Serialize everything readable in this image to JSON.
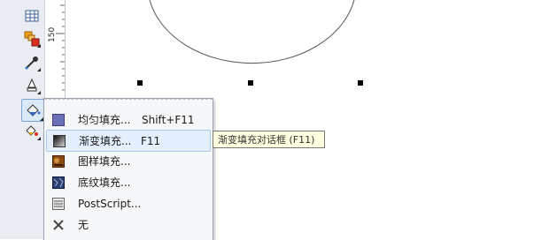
{
  "ruler": {
    "label": "150"
  },
  "toolbox": {
    "tools": [
      {
        "name": "table-tool-icon"
      },
      {
        "name": "blend-tool-icon"
      },
      {
        "name": "eyedropper-tool-icon"
      },
      {
        "name": "outline-tool-icon"
      },
      {
        "name": "fill-tool-icon",
        "active": true
      },
      {
        "name": "interactive-fill-tool-icon"
      }
    ]
  },
  "menu": {
    "items": [
      {
        "label": "均匀填充...",
        "shortcut": "Shift+F11",
        "icon": "uniform-fill-icon"
      },
      {
        "label": "渐变填充...",
        "shortcut": "F11",
        "icon": "fountain-fill-icon",
        "highlighted": true
      },
      {
        "label": "图样填充...",
        "shortcut": "",
        "icon": "pattern-fill-icon"
      },
      {
        "label": "底纹填充...",
        "shortcut": "",
        "icon": "texture-fill-icon"
      },
      {
        "label": "PostScript...",
        "shortcut": "",
        "icon": "postscript-fill-icon"
      },
      {
        "label": "无",
        "shortcut": "",
        "icon": "no-fill-icon"
      }
    ]
  },
  "tooltip": {
    "text": "渐变填充对话框 (F11)"
  },
  "colors": {
    "menu_bg": "#f6f7f9",
    "highlight": "#e3effc",
    "tooltip_bg": "#ffffe1",
    "uniform_fill": "#6a6fb8"
  }
}
